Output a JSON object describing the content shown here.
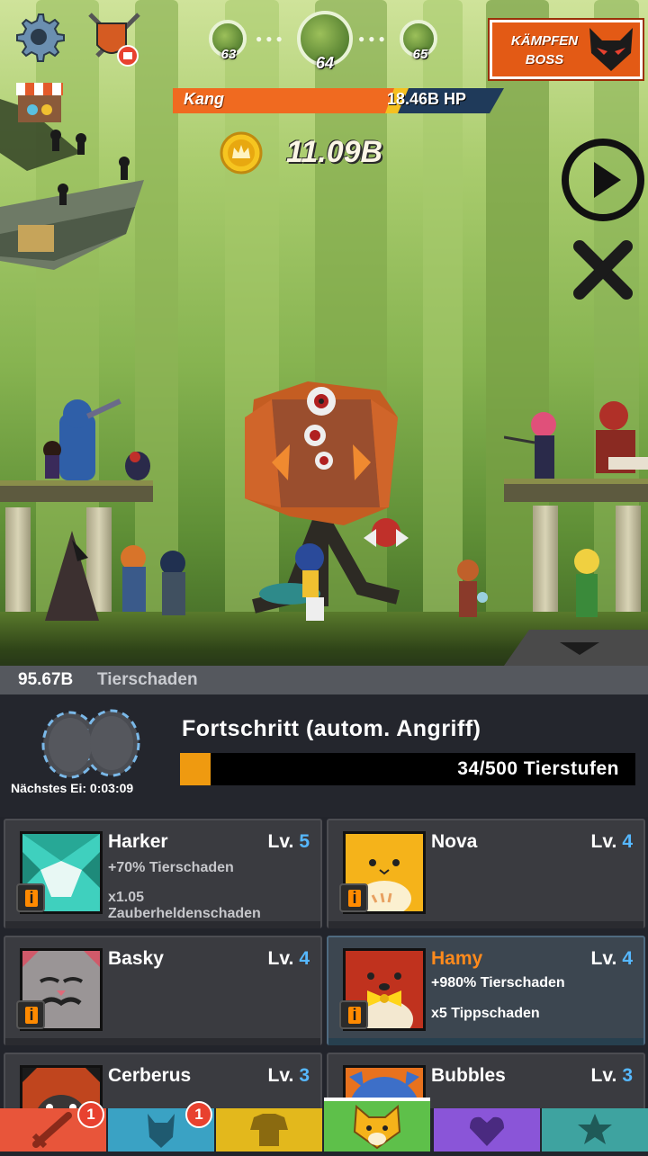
{
  "hud": {
    "stages": [
      {
        "number": "63"
      },
      {
        "number": "64"
      },
      {
        "number": "65"
      }
    ],
    "boss_button": {
      "line1": "KÄMPFEN",
      "line2": "BOSS"
    },
    "enemy": {
      "name": "Kang",
      "hp": "18.46B HP",
      "hp_fraction": 0.7
    },
    "gold": "11.09B",
    "icons": [
      "gear-icon",
      "shield-icon",
      "shop-icon",
      "coin-icon",
      "play-icon",
      "close-icon"
    ]
  },
  "damage_strip": {
    "value": "95.67B",
    "label": "Tierschaden"
  },
  "progress": {
    "egg_timer": "Nächstes Ei: 0:03:09",
    "title": "Fortschritt (autom. Angriff)",
    "text": "34/500 Tierstufen",
    "current": 34,
    "max": 500
  },
  "pets": [
    {
      "name": "Harker",
      "level_label": "Lv.",
      "level": "5",
      "line1": "+70% Tierschaden",
      "line2": "x1.05",
      "line3": "Zauberheldenschaden",
      "info": "i"
    },
    {
      "name": "Nova",
      "level_label": "Lv.",
      "level": "4",
      "info": "i"
    },
    {
      "name": "Basky",
      "level_label": "Lv.",
      "level": "4",
      "info": "i"
    },
    {
      "name": "Hamy",
      "level_label": "Lv.",
      "level": "4",
      "line1": "+980% Tierschaden",
      "line2": "x5 Tippschaden",
      "info": "i",
      "selected": true
    },
    {
      "name": "Cerberus",
      "level_label": "Lv.",
      "level": "3"
    },
    {
      "name": "Bubbles",
      "level_label": "Lv.",
      "level": "3"
    }
  ],
  "tabs": [
    {
      "icon": "sword-icon",
      "color": "#e8553a",
      "badge": "1"
    },
    {
      "icon": "hero-icon",
      "color": "#3aa2c4",
      "badge": "1"
    },
    {
      "icon": "armor-icon",
      "color": "#e3b81c"
    },
    {
      "icon": "pet-icon",
      "color": "#5ec04a",
      "active": true
    },
    {
      "icon": "heart-icon",
      "color": "#8a55d8"
    },
    {
      "icon": "star-icon",
      "color": "#3ea3a0"
    }
  ]
}
